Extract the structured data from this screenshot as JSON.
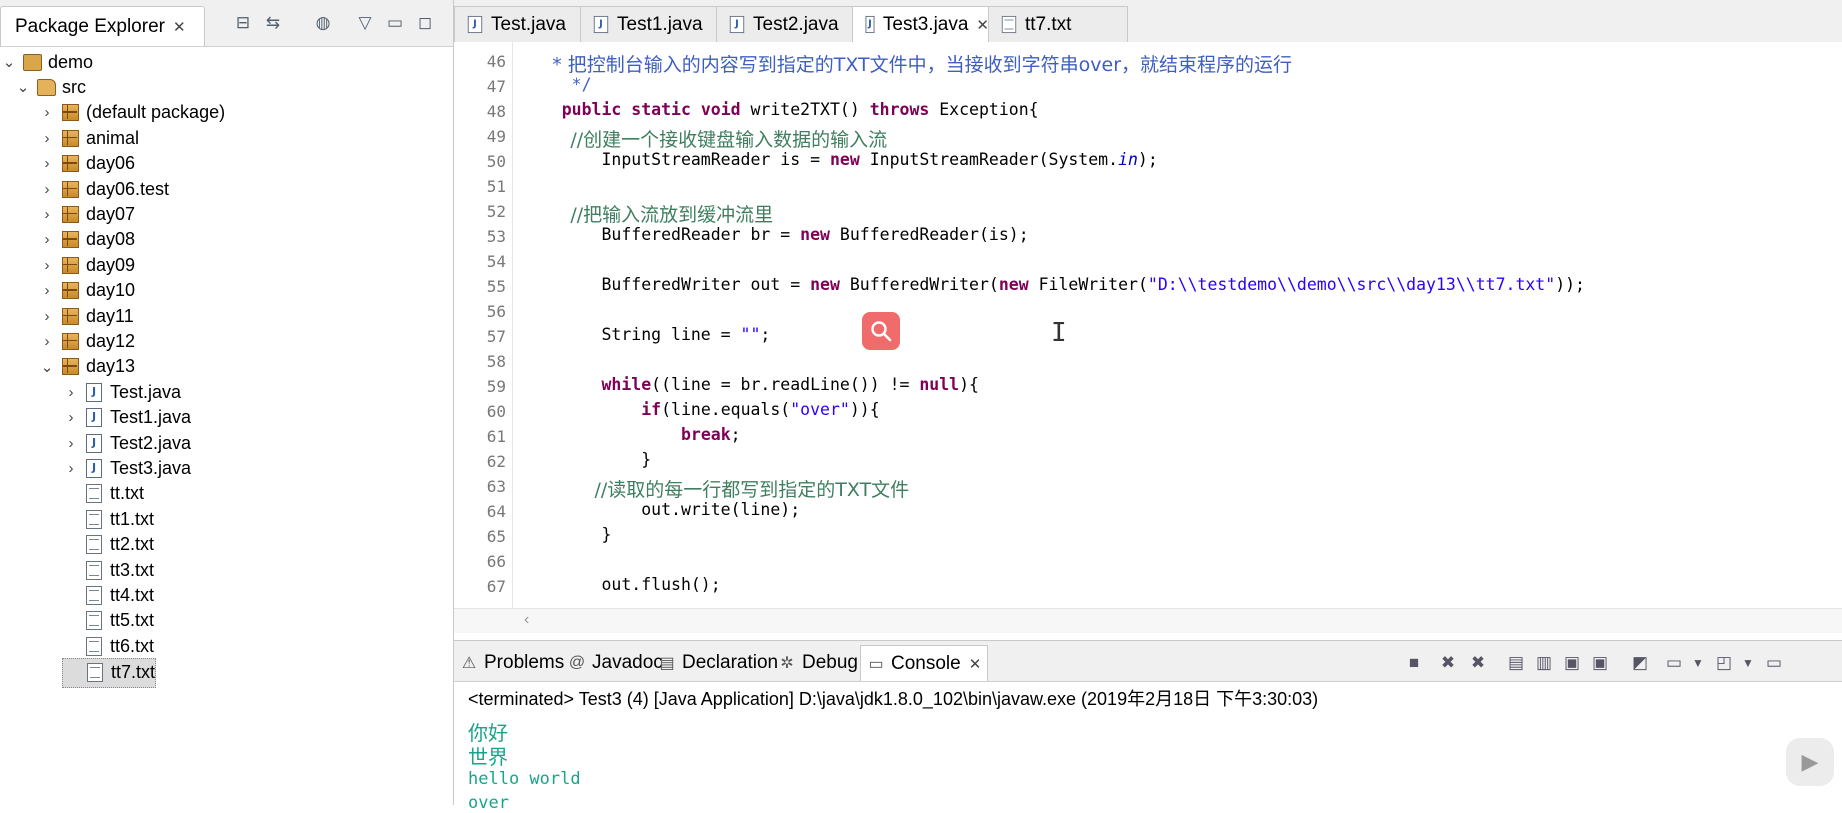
{
  "package_explorer": {
    "title": "Package Explorer",
    "tree": [
      {
        "label": "demo",
        "type": "project",
        "level": 0,
        "expanded": true
      },
      {
        "label": "src",
        "type": "source-folder",
        "level": 1,
        "expanded": true
      },
      {
        "label": "(default package)",
        "type": "package",
        "level": 2,
        "expanded": false
      },
      {
        "label": "animal",
        "type": "package",
        "level": 2,
        "expanded": false
      },
      {
        "label": "day06",
        "type": "package",
        "level": 2,
        "expanded": false
      },
      {
        "label": "day06.test",
        "type": "package",
        "level": 2,
        "expanded": false
      },
      {
        "label": "day07",
        "type": "package",
        "level": 2,
        "expanded": false
      },
      {
        "label": "day08",
        "type": "package",
        "level": 2,
        "expanded": false
      },
      {
        "label": "day09",
        "type": "package",
        "level": 2,
        "expanded": false
      },
      {
        "label": "day10",
        "type": "package",
        "level": 2,
        "expanded": false
      },
      {
        "label": "day11",
        "type": "package",
        "level": 2,
        "expanded": false
      },
      {
        "label": "day12",
        "type": "package",
        "level": 2,
        "expanded": false
      },
      {
        "label": "day13",
        "type": "package",
        "level": 2,
        "expanded": true
      },
      {
        "label": "Test.java",
        "type": "java",
        "level": 3,
        "expanded": false
      },
      {
        "label": "Test1.java",
        "type": "java",
        "level": 3,
        "expanded": false
      },
      {
        "label": "Test2.java",
        "type": "java",
        "level": 3,
        "expanded": false
      },
      {
        "label": "Test3.java",
        "type": "java",
        "level": 3,
        "expanded": false
      },
      {
        "label": "tt.txt",
        "type": "txt",
        "level": 3
      },
      {
        "label": "tt1.txt",
        "type": "txt",
        "level": 3
      },
      {
        "label": "tt2.txt",
        "type": "txt",
        "level": 3
      },
      {
        "label": "tt3.txt",
        "type": "txt",
        "level": 3
      },
      {
        "label": "tt4.txt",
        "type": "txt",
        "level": 3
      },
      {
        "label": "tt5.txt",
        "type": "txt",
        "level": 3
      },
      {
        "label": "tt6.txt",
        "type": "txt",
        "level": 3
      },
      {
        "label": "tt7.txt",
        "type": "txt",
        "level": 3,
        "selected": true
      }
    ]
  },
  "editor_tabs": [
    {
      "label": "Test.java",
      "type": "java"
    },
    {
      "label": "Test1.java",
      "type": "java"
    },
    {
      "label": "Test2.java",
      "type": "java"
    },
    {
      "label": "Test3.java",
      "type": "java",
      "active": true
    },
    {
      "label": "tt7.txt",
      "type": "txt"
    }
  ],
  "code_lines": [
    {
      "n": "46",
      "tokens": [
        [
          "jd",
          "     * 把控制台输入的内容写到指定的TXT文件中，当接收到字符串over，就结束程序的运行"
        ]
      ]
    },
    {
      "n": "47",
      "tokens": [
        [
          "jd",
          "     */"
        ]
      ]
    },
    {
      "n": "48",
      "tokens": [
        [
          "",
          "    "
        ],
        [
          "kw",
          "public static void"
        ],
        [
          "",
          " write2TXT() "
        ],
        [
          "kw",
          "throws"
        ],
        [
          "",
          " Exception{"
        ]
      ]
    },
    {
      "n": "49",
      "tokens": [
        [
          "cm",
          "        //创建一个接收键盘输入数据的输入流"
        ]
      ]
    },
    {
      "n": "50",
      "tokens": [
        [
          "",
          "        InputStreamReader is = "
        ],
        [
          "kw",
          "new"
        ],
        [
          "",
          " InputStreamReader(System."
        ],
        [
          "fd",
          "in"
        ],
        [
          "",
          ");"
        ]
      ]
    },
    {
      "n": "51",
      "tokens": []
    },
    {
      "n": "52",
      "tokens": [
        [
          "cm",
          "        //把输入流放到缓冲流里"
        ]
      ]
    },
    {
      "n": "53",
      "tokens": [
        [
          "",
          "        BufferedReader br = "
        ],
        [
          "kw",
          "new"
        ],
        [
          "",
          " BufferedReader(is);"
        ]
      ]
    },
    {
      "n": "54",
      "tokens": []
    },
    {
      "n": "55",
      "tokens": [
        [
          "",
          "        BufferedWriter out = "
        ],
        [
          "kw",
          "new"
        ],
        [
          "",
          " BufferedWriter("
        ],
        [
          "kw",
          "new"
        ],
        [
          "",
          " FileWriter("
        ],
        [
          "st",
          "\"D:\\\\testdemo\\\\demo\\\\src\\\\day13\\\\tt7.txt\""
        ],
        [
          "",
          "));"
        ]
      ]
    },
    {
      "n": "56",
      "tokens": []
    },
    {
      "n": "57",
      "tokens": [
        [
          "",
          "        String line = "
        ],
        [
          "st",
          "\"\""
        ],
        [
          "",
          ";"
        ]
      ]
    },
    {
      "n": "58",
      "tokens": []
    },
    {
      "n": "59",
      "tokens": [
        [
          "",
          "        "
        ],
        [
          "kw",
          "while"
        ],
        [
          "",
          "((line = br.readLine()) != "
        ],
        [
          "kw",
          "null"
        ],
        [
          "",
          "){"
        ]
      ]
    },
    {
      "n": "60",
      "tokens": [
        [
          "",
          "            "
        ],
        [
          "kw",
          "if"
        ],
        [
          "",
          "(line.equals("
        ],
        [
          "st",
          "\"over\""
        ],
        [
          "",
          ")){"
        ]
      ]
    },
    {
      "n": "61",
      "tokens": [
        [
          "",
          "                "
        ],
        [
          "kw",
          "break"
        ],
        [
          "",
          ";"
        ]
      ]
    },
    {
      "n": "62",
      "tokens": [
        [
          "",
          "            }"
        ]
      ]
    },
    {
      "n": "63",
      "tokens": [
        [
          "cm",
          "            //读取的每一行都写到指定的TXT文件"
        ]
      ]
    },
    {
      "n": "64",
      "tokens": [
        [
          "",
          "            out.write(line);"
        ]
      ]
    },
    {
      "n": "65",
      "tokens": [
        [
          "",
          "        }"
        ]
      ]
    },
    {
      "n": "66",
      "tokens": []
    },
    {
      "n": "67",
      "tokens": [
        [
          "",
          "        out.flush();"
        ]
      ]
    }
  ],
  "console_tabs": [
    {
      "label": "Problems",
      "icon": "problems-icon",
      "glyph": "⚠"
    },
    {
      "label": "Javadoc",
      "icon": "at-icon",
      "glyph": "@"
    },
    {
      "label": "Declaration",
      "icon": "declaration-icon",
      "glyph": "▤"
    },
    {
      "label": "Debug",
      "icon": "bug-icon",
      "glyph": "✲"
    },
    {
      "label": "Console",
      "icon": "console-icon",
      "glyph": "▭",
      "active": true
    }
  ],
  "console": {
    "status": "<terminated> Test3 (4) [Java Application] D:\\java\\jdk1.8.0_102\\bin\\javaw.exe (2019年2月18日 下午3:30:03)",
    "output": [
      "你好",
      "世界",
      "hello world",
      "over"
    ]
  },
  "colors": {
    "keyword": "#7f0055",
    "comment": "#3f7f5f",
    "javadoc": "#3f5fbf",
    "string": "#2a00ff",
    "console_output": "#19a58a",
    "search_bubble": "#f06b6b"
  }
}
